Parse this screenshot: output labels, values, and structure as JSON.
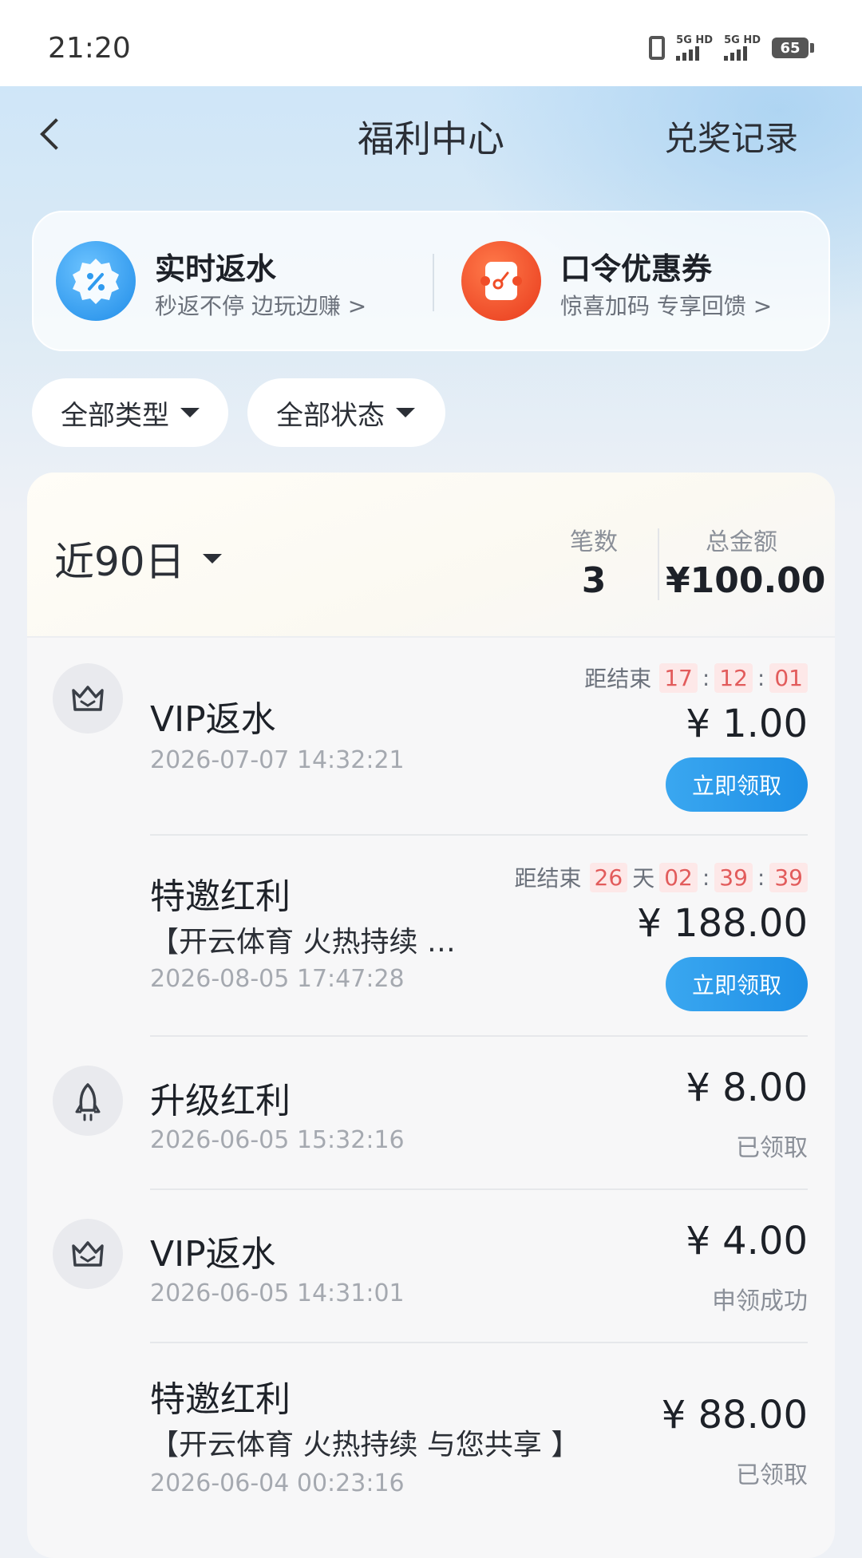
{
  "status_bar": {
    "time": "21:20",
    "network1": "5G HD",
    "network2": "5G HD",
    "battery": "65"
  },
  "nav": {
    "title": "福利中心",
    "right_link": "兑奖记录"
  },
  "promos": [
    {
      "title": "实时返水",
      "subtitle": "秒返不停 边玩边赚 >",
      "icon": "percent-badge-icon",
      "color": "#2f9bef"
    },
    {
      "title": "口令优惠券",
      "subtitle": "惊喜加码 专享回馈 >",
      "icon": "ticket-icon",
      "color": "#f24e2b"
    }
  ],
  "filters": {
    "type": "全部类型",
    "status": "全部状态"
  },
  "summary": {
    "period": "近90日",
    "count_label": "笔数",
    "count": "3",
    "total_label": "总金额",
    "total": "¥100.00"
  },
  "records": [
    {
      "icon": "crown-icon",
      "title": "VIP返水",
      "date": "2026-07-07 14:32:21",
      "amount": "¥ 1.00",
      "countdown": {
        "label": "距结束",
        "h": "17",
        "m": "12",
        "s": "01"
      },
      "action": "立即领取"
    },
    {
      "title": "特邀红利",
      "subtitle": "【开云体育 火热持续 …",
      "date": "2026-08-05 17:47:28",
      "amount": "¥ 188.00",
      "countdown": {
        "label": "距结束",
        "d": "26",
        "d_unit": "天",
        "h": "02",
        "m": "39",
        "s": "39"
      },
      "action": "立即领取"
    },
    {
      "icon": "rocket-icon",
      "title": "升级红利",
      "date": "2026-06-05 15:32:16",
      "amount": "¥ 8.00",
      "status": "已领取"
    },
    {
      "icon": "crown-icon",
      "title": "VIP返水",
      "date": "2026-06-05 14:31:01",
      "amount": "¥ 4.00",
      "status": "申领成功"
    },
    {
      "title": "特邀红利",
      "subtitle": "【开云体育 火热持续 与您共享 】",
      "date": "2026-06-04 00:23:16",
      "amount": "¥ 88.00",
      "status": "已领取"
    }
  ]
}
